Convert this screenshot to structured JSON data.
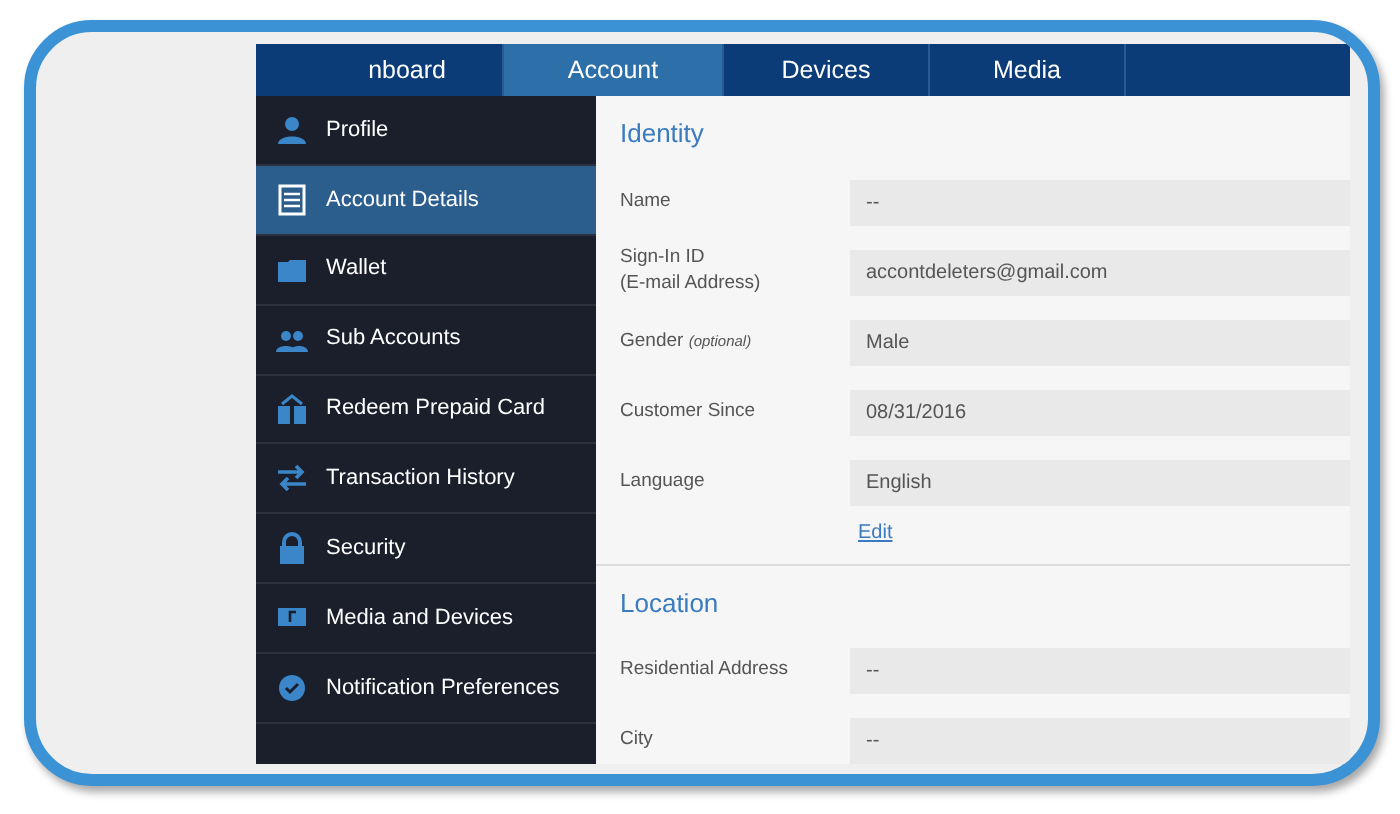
{
  "tabs": [
    {
      "label": "nboard",
      "selected": false
    },
    {
      "label": "Account",
      "selected": true
    },
    {
      "label": "Devices",
      "selected": false
    },
    {
      "label": "Media",
      "selected": false
    }
  ],
  "sidebar": {
    "items": [
      {
        "label": "Profile",
        "selected": false
      },
      {
        "label": "Account Details",
        "selected": true
      },
      {
        "label": "Wallet",
        "selected": false
      },
      {
        "label": "Sub Accounts",
        "selected": false
      },
      {
        "label": "Redeem Prepaid Card",
        "selected": false
      },
      {
        "label": "Transaction History",
        "selected": false
      },
      {
        "label": "Security",
        "selected": false
      },
      {
        "label": "Media and Devices",
        "selected": false
      },
      {
        "label": "Notification Preferences",
        "selected": false
      }
    ]
  },
  "sections": [
    {
      "title": "Identity",
      "fields": [
        {
          "label": "Name",
          "value": "--"
        },
        {
          "label": "Sign-In ID\n(E-mail Address)",
          "value": "accontdeleters@gmail.com"
        },
        {
          "label": "Gender *(optional)*",
          "value": "Male"
        },
        {
          "label": "Customer Since",
          "value": "08/31/2016"
        },
        {
          "label": "Language",
          "value": "English"
        }
      ],
      "link": "Edit"
    },
    {
      "title": "Location",
      "fields": [
        {
          "label": "Residential Address",
          "value": "--"
        },
        {
          "label": "City",
          "value": "--"
        }
      ]
    }
  ]
}
